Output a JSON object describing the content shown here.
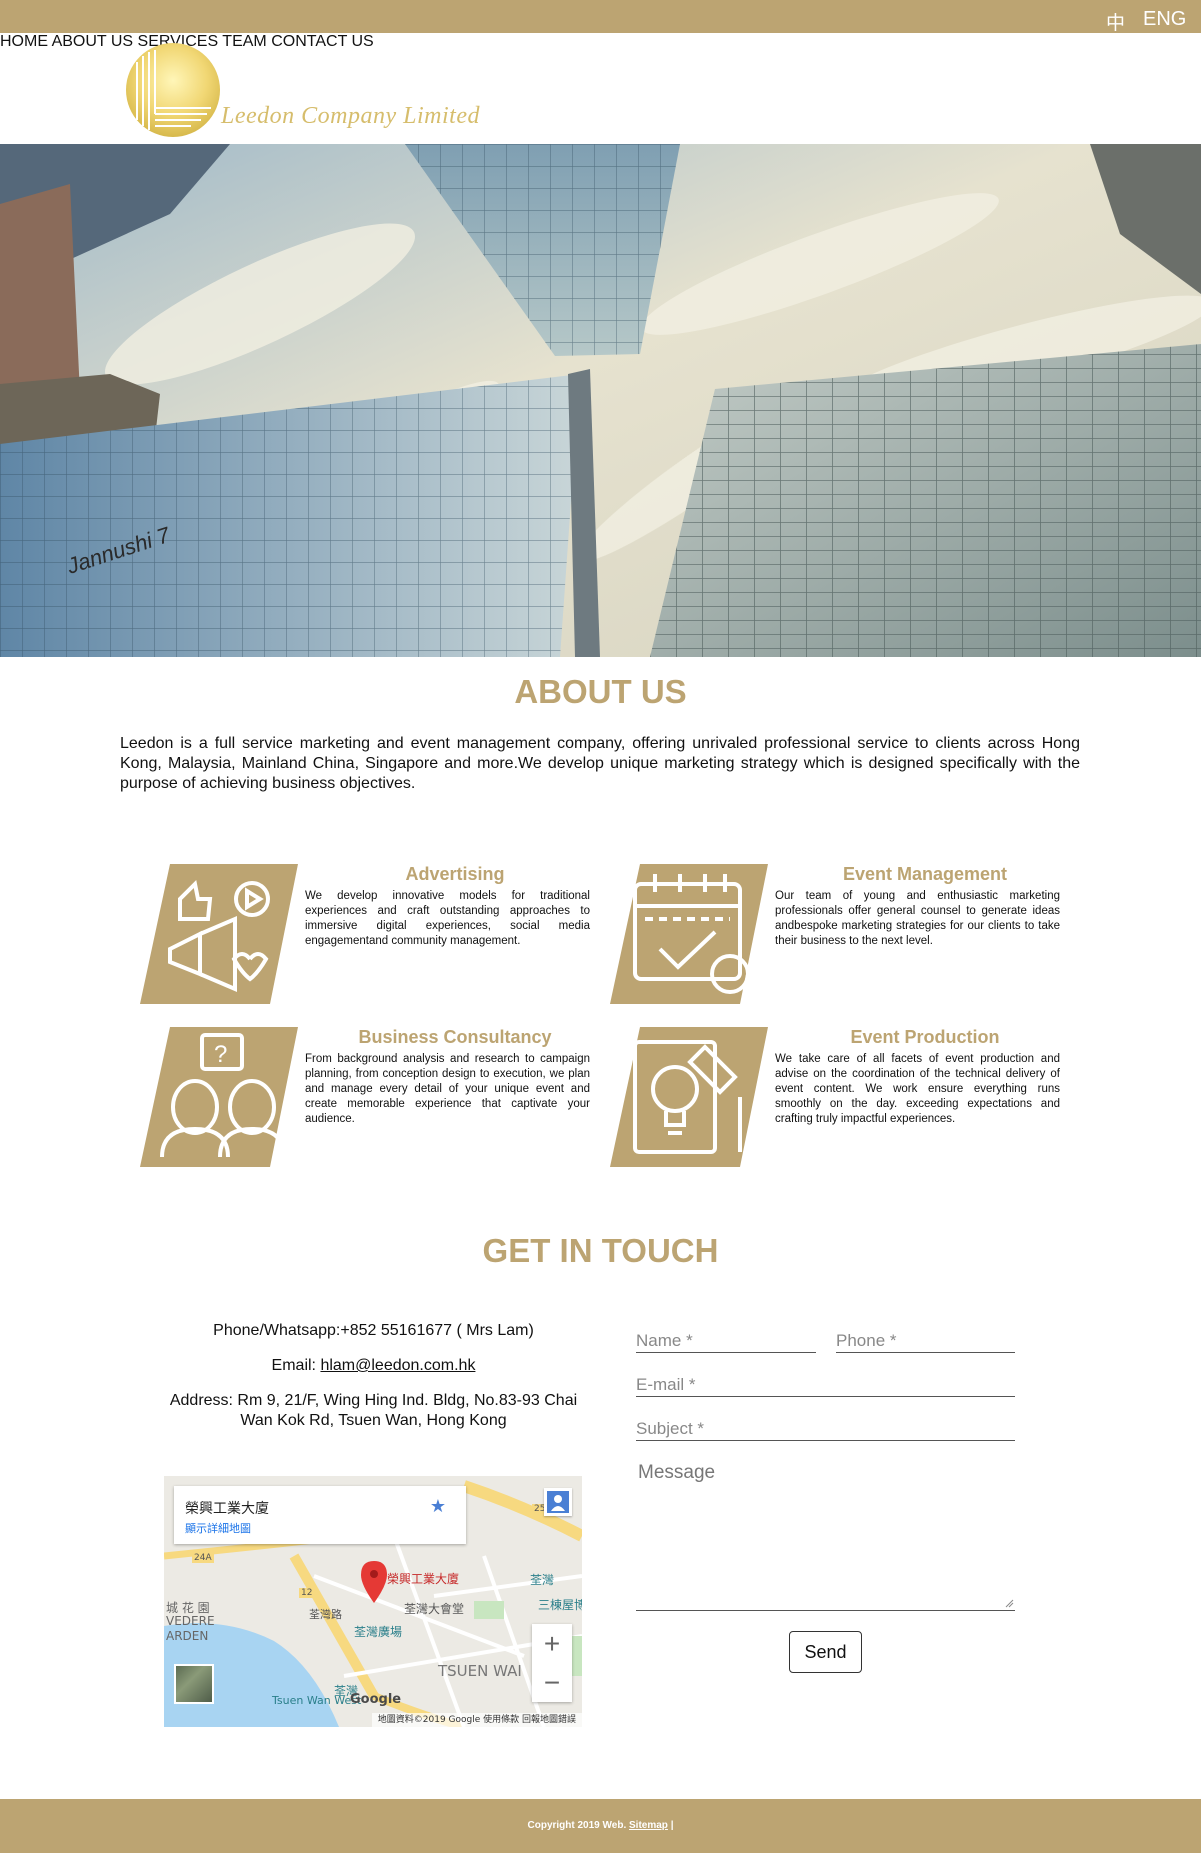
{
  "topbar": {
    "lang_zh": "中",
    "lang_en": "ENG"
  },
  "brand": {
    "name": "Leedon Company Limited"
  },
  "nav": [
    "HOME",
    "ABOUT US",
    "SERVICES",
    "TEAM",
    "CONTACT US"
  ],
  "about": {
    "title": "ABOUT US",
    "text": "Leedon is a full service marketing and event management company, offering unrivaled professional service to clients across Hong Kong, Malaysia, Mainland China, Singapore and more.We develop unique marketing strategy which is designed specifically with the purpose of achieving business objectives."
  },
  "services": [
    {
      "title": "Advertising",
      "icon": "megaphone-icon",
      "text": "We develop innovative models for traditional experiences and craft outstanding approaches to immersive digital experiences, social media engagementand community management."
    },
    {
      "title": "Event Management",
      "icon": "calendar-check-icon",
      "text": "Our team of young and enthusiastic marketing professionals offer general counsel to generate ideas andbespoke marketing strategies for our clients to take their business to the next level."
    },
    {
      "title": "Business Consultancy",
      "icon": "consultants-icon",
      "text": "From background analysis and research to campaign planning, from conception design to execution, we plan and manage every detail of your unique event and create memorable experience that captivate your audience."
    },
    {
      "title": "Event Production",
      "icon": "lightbulb-document-icon",
      "text": "We take care of all facets of event production and advise on the coordination of the technical delivery of event content. We work ensure everything runs smoothly on the day. exceeding expectations and crafting truly impactful experiences."
    }
  ],
  "contact": {
    "title": "GET IN TOUCH",
    "phone": "Phone/Whatsapp:+852 55161677 ( Mrs Lam)",
    "email_label": "Email: ",
    "email": "hlam@leedon.com.hk",
    "address_line1": "Address: Rm 9, 21/F, Wing Hing Ind. Bldg, No.83-93 Chai",
    "address_line2": "Wan Kok Rd, Tsuen Wan, Hong Kong"
  },
  "map": {
    "place_name": "榮興工業大廈",
    "view_larger": "顯示詳細地圖",
    "pin_label": "榮興工業大廈",
    "labels": [
      "荃灣",
      "三棟屋博",
      "荃灣大會堂",
      "荃灣廣場",
      "城 花 園",
      "VEDERE",
      "ARDEN",
      "TSUEN WAI",
      "荃灣",
      "Tsuen Wan West",
      "荃灣路",
      "24A",
      "12",
      "25"
    ],
    "footer": "地圖資料©2019 Google   使用條款   回報地圖錯誤",
    "google": "Google"
  },
  "form": {
    "name_placeholder": "Name *",
    "phone_placeholder": "Phone *",
    "email_placeholder": "E-mail *",
    "subject_placeholder": "Subject *",
    "message_placeholder": "Message",
    "send_label": "Send"
  },
  "footer": {
    "copyright": "Copyright 2019 Web. ",
    "sitemap": "Sitemap",
    "separator": " |"
  },
  "colors": {
    "gold": "#bca472",
    "logo_gold": "#d6bd6c"
  }
}
